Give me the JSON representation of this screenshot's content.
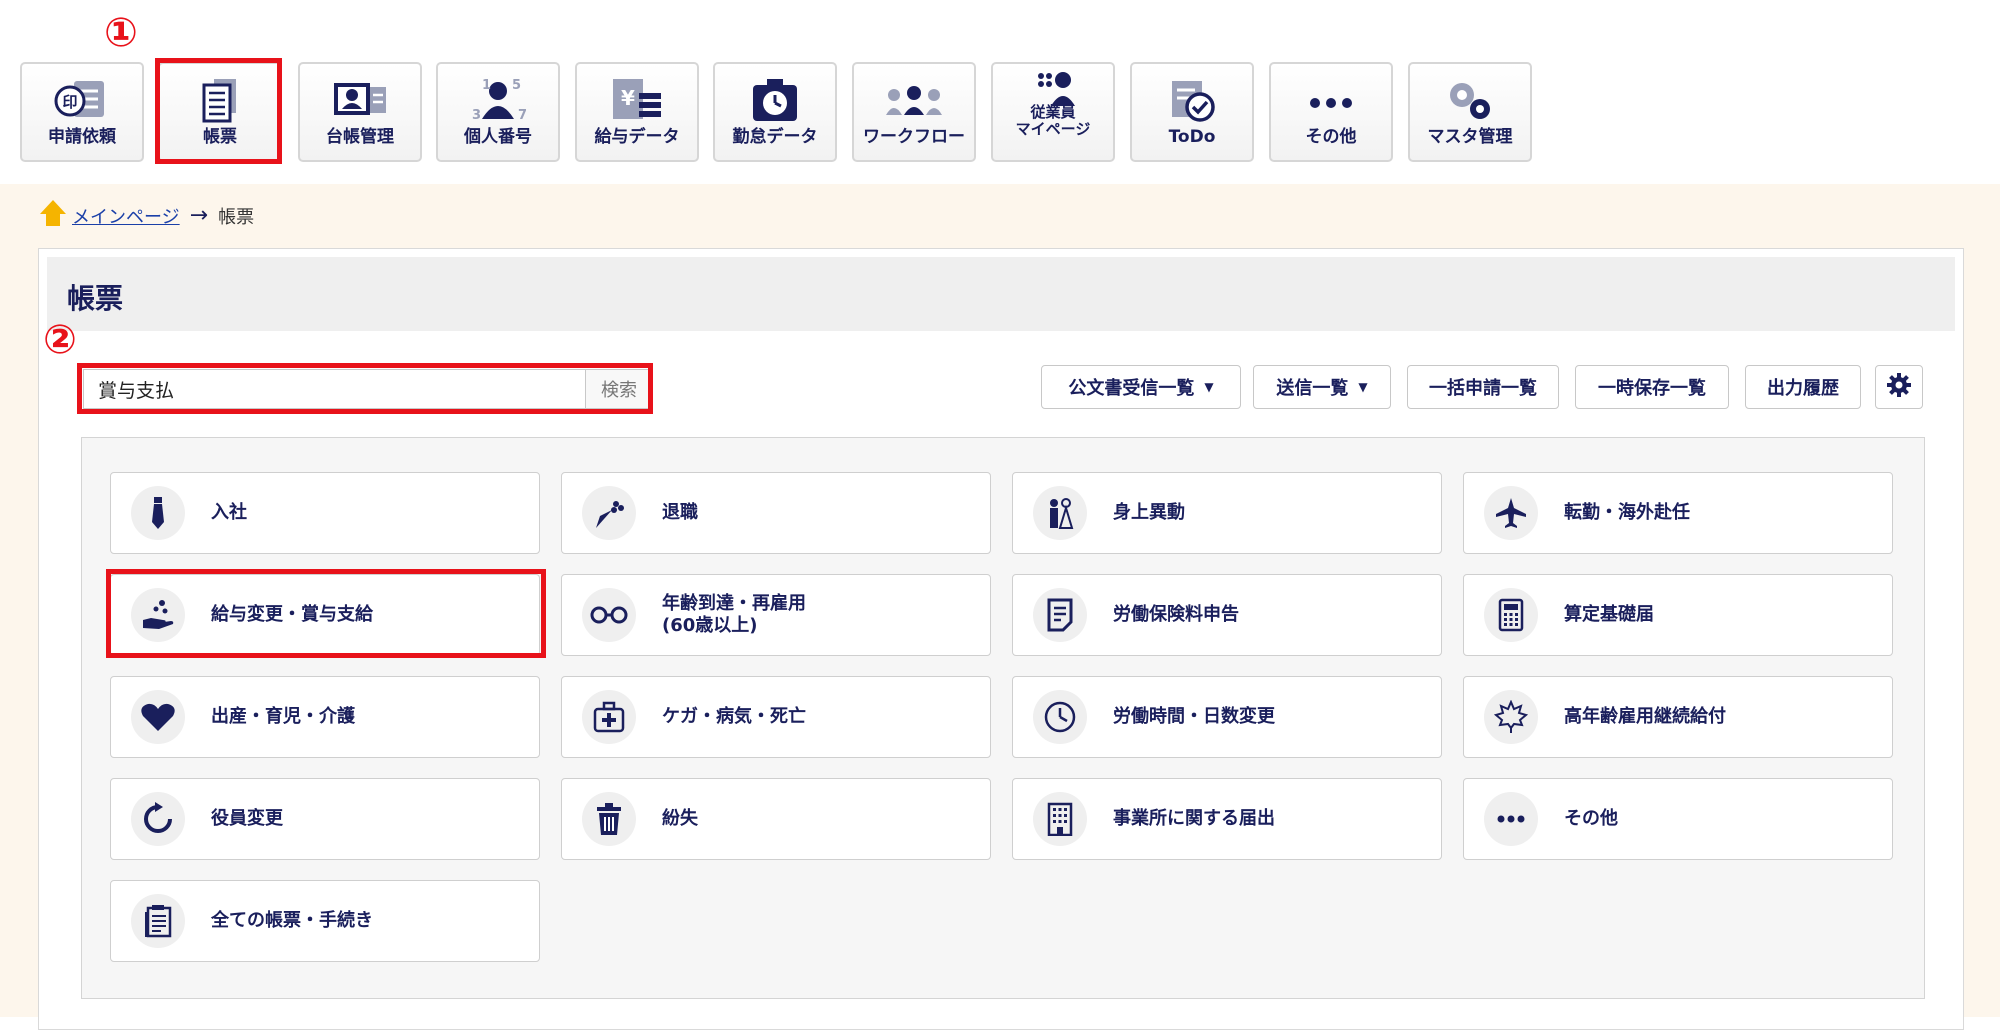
{
  "nav": {
    "items": [
      {
        "label": "申請依頼",
        "icon": "stamp-document-icon"
      },
      {
        "label": "帳票",
        "icon": "form-document-icon"
      },
      {
        "label": "台帳管理",
        "icon": "ledger-icon"
      },
      {
        "label": "個人番号",
        "icon": "personal-number-icon"
      },
      {
        "label": "給与データ",
        "icon": "salary-data-icon"
      },
      {
        "label": "勤怠データ",
        "icon": "attendance-clock-icon"
      },
      {
        "label": "ワークフロー",
        "icon": "workflow-people-icon"
      },
      {
        "label": "従業員\nマイページ",
        "icon": "employee-mypage-icon"
      },
      {
        "label": "ToDo",
        "icon": "todo-check-icon"
      },
      {
        "label": "その他",
        "icon": "more-dots-icon"
      },
      {
        "label": "マスタ管理",
        "icon": "gears-icon"
      }
    ]
  },
  "annotations": {
    "marker1": "①",
    "marker2": "②"
  },
  "breadcrumb": {
    "home": "メインページ",
    "arrow": "→",
    "current": "帳票"
  },
  "page": {
    "title": "帳票"
  },
  "search": {
    "value": "賞与支払",
    "button": "検索"
  },
  "toolbar": {
    "received_docs": "公文書受信一覧",
    "sent_list": "送信一覧",
    "bulk_list": "一括申請一覧",
    "temp_saved": "一時保存一覧",
    "output_history": "出力履歴"
  },
  "categories": [
    {
      "label": "入社",
      "icon": "necktie-icon"
    },
    {
      "label": "退職",
      "icon": "bouquet-icon"
    },
    {
      "label": "身上異動",
      "icon": "wedding-couple-icon"
    },
    {
      "label": "転勤・海外赴任",
      "icon": "airplane-icon"
    },
    {
      "label": "給与変更・賞与支給",
      "icon": "hand-coins-icon"
    },
    {
      "label": "年齢到達・再雇用\n(60歳以上)",
      "icon": "glasses-icon"
    },
    {
      "label": "労働保険料申告",
      "icon": "document-lines-icon"
    },
    {
      "label": "算定基礎届",
      "icon": "calculator-icon"
    },
    {
      "label": "出産・育児・介護",
      "icon": "heart-icon"
    },
    {
      "label": "ケガ・病気・死亡",
      "icon": "first-aid-kit-icon"
    },
    {
      "label": "労働時間・日数変更",
      "icon": "clock-icon"
    },
    {
      "label": "高年齢雇用継続給付",
      "icon": "maple-leaf-icon"
    },
    {
      "label": "役員変更",
      "icon": "refresh-icon"
    },
    {
      "label": "紛失",
      "icon": "trash-icon"
    },
    {
      "label": "事業所に関する届出",
      "icon": "building-icon"
    },
    {
      "label": "その他",
      "icon": "more-dots-icon"
    },
    {
      "label": "全ての帳票・手続き",
      "icon": "documents-stack-icon"
    }
  ],
  "colors": {
    "navy": "#1a1f5c",
    "highlight": "#e8121a",
    "background": "#fdf6ec",
    "link": "#1a3fa8"
  }
}
